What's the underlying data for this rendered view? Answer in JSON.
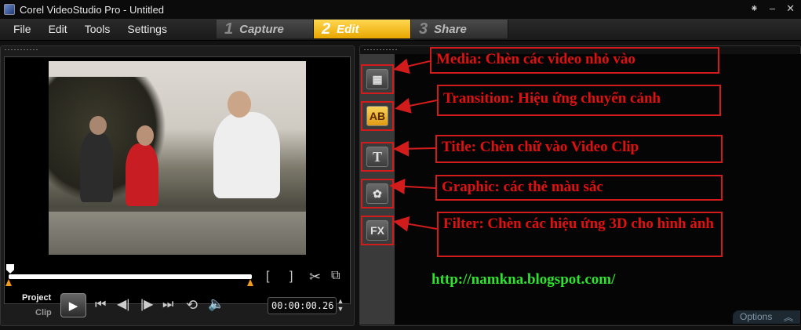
{
  "window": {
    "title": "Corel VideoStudio Pro - Untitled",
    "controls": [
      "⁕",
      "–",
      "✕"
    ]
  },
  "menu": [
    "File",
    "Edit",
    "Tools",
    "Settings"
  ],
  "steps": [
    {
      "num": "1",
      "label": "Capture",
      "active": false
    },
    {
      "num": "2",
      "label": "Edit",
      "active": true
    },
    {
      "num": "3",
      "label": "Share",
      "active": false
    }
  ],
  "player": {
    "project_label": "Project",
    "clip_label": "Clip",
    "timecode": "00:00:00.26",
    "mark_in": "[",
    "mark_out": "]"
  },
  "library": {
    "icons": [
      {
        "name": "media",
        "glyph": "▦"
      },
      {
        "name": "transition",
        "glyph": "AB"
      },
      {
        "name": "title",
        "glyph": "T"
      },
      {
        "name": "graphic",
        "glyph": "✿"
      },
      {
        "name": "filter",
        "glyph": "FX"
      }
    ],
    "options_label": "Options"
  },
  "annotations": {
    "media": "Media: Chèn các video nhỏ vào",
    "transition": "Transition: Hiệu ứng chuyển cảnh",
    "title": "Title: Chèn chữ vào Video Clip",
    "graphic": "Graphic: các thẻ màu sắc",
    "filter": "Filter: Chèn các hiệu ứng 3D cho hình ảnh"
  },
  "url": "http://namkna.blogspot.com/",
  "colors": {
    "annotation_red": "#d21c1c",
    "url_green": "#2ee32e",
    "active_step": "#f5c020"
  }
}
